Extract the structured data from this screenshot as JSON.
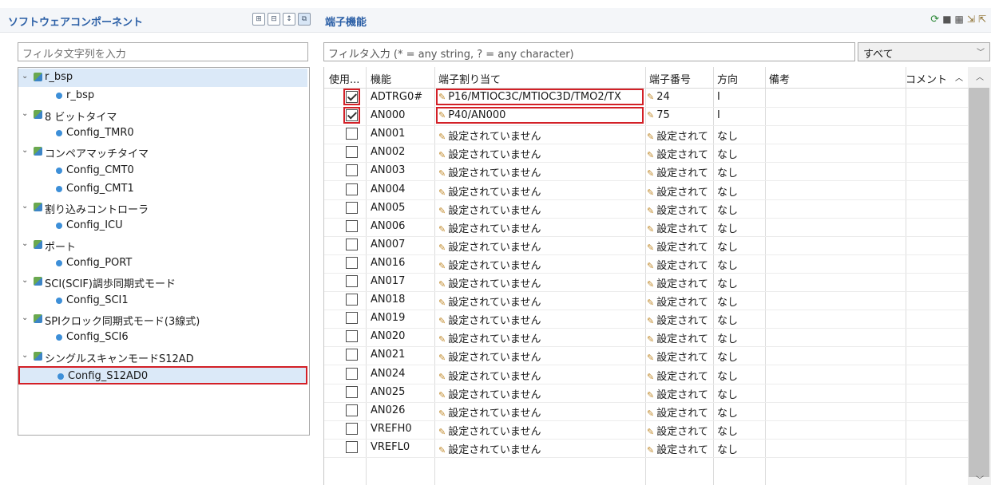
{
  "left": {
    "title": "ソフトウェアコンポーネント",
    "filter_placeholder": "フィルタ文字列を入力",
    "tree": [
      {
        "label": "r_bsp",
        "level": 0
      },
      {
        "label": "r_bsp",
        "level": 1
      },
      {
        "label": "8 ビットタイマ",
        "level": 0
      },
      {
        "label": "Config_TMR0",
        "level": 1
      },
      {
        "label": "コンペアマッチタイマ",
        "level": 0
      },
      {
        "label": "Config_CMT0",
        "level": 1
      },
      {
        "label": "Config_CMT1",
        "level": 1
      },
      {
        "label": "割り込みコントローラ",
        "level": 0
      },
      {
        "label": "Config_ICU",
        "level": 1
      },
      {
        "label": "ポート",
        "level": 0
      },
      {
        "label": "Config_PORT",
        "level": 1
      },
      {
        "label": "SCI(SCIF)調歩同期式モード",
        "level": 0
      },
      {
        "label": "Config_SCI1",
        "level": 1
      },
      {
        "label": "SPIクロック同期式モード(3線式)",
        "level": 0
      },
      {
        "label": "Config_SCI6",
        "level": 1
      },
      {
        "label": "シングルスキャンモードS12AD",
        "level": 0
      },
      {
        "label": "Config_S12AD0",
        "level": 1
      }
    ]
  },
  "right": {
    "title": "端子機能",
    "filter_placeholder": "フィルタ入力 (* = any string, ? = any character)",
    "filter_combo": "すべて",
    "columns": [
      "使用...",
      "機能",
      "端子割り当て",
      "端子番号",
      "方向",
      "備考",
      "コメント"
    ],
    "rows": [
      {
        "used": true,
        "func": "ADTRG0#",
        "pin": "P16/MTIOC3C/MTIOC3D/TMO2/TX",
        "num": "24",
        "dir": "I"
      },
      {
        "used": true,
        "func": "AN000",
        "pin": "P40/AN000",
        "num": "75",
        "dir": "I"
      },
      {
        "used": false,
        "func": "AN001",
        "pin": "設定されていません",
        "num": "設定されて",
        "dir": "なし"
      },
      {
        "used": false,
        "func": "AN002",
        "pin": "設定されていません",
        "num": "設定されて",
        "dir": "なし"
      },
      {
        "used": false,
        "func": "AN003",
        "pin": "設定されていません",
        "num": "設定されて",
        "dir": "なし"
      },
      {
        "used": false,
        "func": "AN004",
        "pin": "設定されていません",
        "num": "設定されて",
        "dir": "なし"
      },
      {
        "used": false,
        "func": "AN005",
        "pin": "設定されていません",
        "num": "設定されて",
        "dir": "なし"
      },
      {
        "used": false,
        "func": "AN006",
        "pin": "設定されていません",
        "num": "設定されて",
        "dir": "なし"
      },
      {
        "used": false,
        "func": "AN007",
        "pin": "設定されていません",
        "num": "設定されて",
        "dir": "なし"
      },
      {
        "used": false,
        "func": "AN016",
        "pin": "設定されていません",
        "num": "設定されて",
        "dir": "なし"
      },
      {
        "used": false,
        "func": "AN017",
        "pin": "設定されていません",
        "num": "設定されて",
        "dir": "なし"
      },
      {
        "used": false,
        "func": "AN018",
        "pin": "設定されていません",
        "num": "設定されて",
        "dir": "なし"
      },
      {
        "used": false,
        "func": "AN019",
        "pin": "設定されていません",
        "num": "設定されて",
        "dir": "なし"
      },
      {
        "used": false,
        "func": "AN020",
        "pin": "設定されていません",
        "num": "設定されて",
        "dir": "なし"
      },
      {
        "used": false,
        "func": "AN021",
        "pin": "設定されていません",
        "num": "設定されて",
        "dir": "なし"
      },
      {
        "used": false,
        "func": "AN024",
        "pin": "設定されていません",
        "num": "設定されて",
        "dir": "なし"
      },
      {
        "used": false,
        "func": "AN025",
        "pin": "設定されていません",
        "num": "設定されて",
        "dir": "なし"
      },
      {
        "used": false,
        "func": "AN026",
        "pin": "設定されていません",
        "num": "設定されて",
        "dir": "なし"
      },
      {
        "used": false,
        "func": "VREFH0",
        "pin": "設定されていません",
        "num": "設定されて",
        "dir": "なし"
      },
      {
        "used": false,
        "func": "VREFL0",
        "pin": "設定されていません",
        "num": "設定されて",
        "dir": "なし"
      }
    ]
  }
}
